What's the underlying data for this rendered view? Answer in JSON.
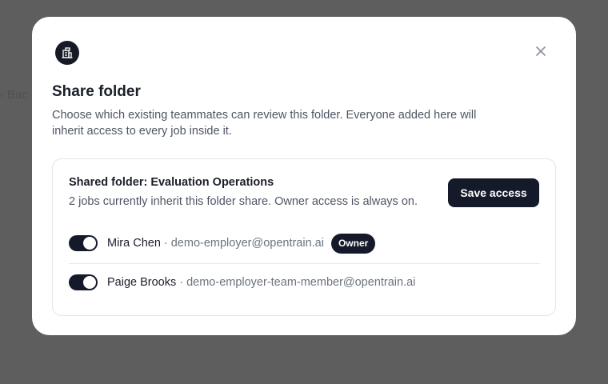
{
  "background": {
    "ghost_text": "‹ Bac"
  },
  "dialog": {
    "logo_icon": "building-icon",
    "close_icon": "close-icon",
    "title": "Share folder",
    "description": "Choose which existing teammates can review this folder. Everyone added here will inherit access to every job inside it.",
    "panel": {
      "title": "Shared folder: Evaluation Operations",
      "subtitle": "2 jobs currently inherit this folder share. Owner access is always on.",
      "save_label": "Save access",
      "separator": "·",
      "members": [
        {
          "name": "Mira Chen",
          "email": "demo-employer@opentrain.ai",
          "badge": "Owner",
          "enabled": true
        },
        {
          "name": "Paige Brooks",
          "email": "demo-employer-team-member@opentrain.ai",
          "enabled": true
        }
      ]
    }
  },
  "colors": {
    "overlay": "#5e5e5e",
    "primary": "#141a29",
    "text": "#1b1f2a",
    "muted": "#4e5563"
  }
}
